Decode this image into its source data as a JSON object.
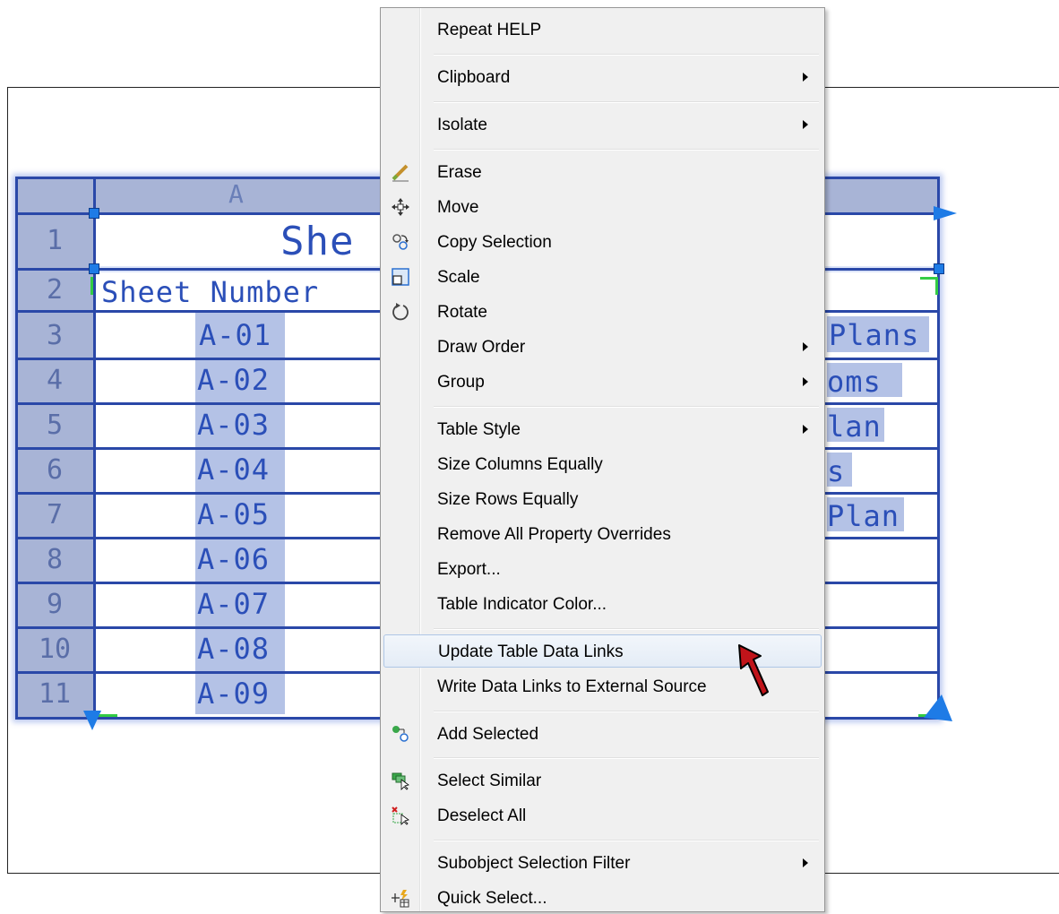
{
  "table": {
    "column_header": "A",
    "row_numbers": [
      "1",
      "2",
      "3",
      "4",
      "5",
      "6",
      "7",
      "8",
      "9",
      "10",
      "11"
    ],
    "title_fragment": "She",
    "header_fragment": "Sheet Number",
    "sheet_numbers": [
      "A-01",
      "A-02",
      "A-03",
      "A-04",
      "A-05",
      "A-06",
      "A-07",
      "A-08",
      "A-09"
    ],
    "right_fragments": [
      "Plans",
      "oms",
      "lan",
      "s",
      "Plan"
    ]
  },
  "menu": {
    "repeat_help": "Repeat HELP",
    "clipboard": "Clipboard",
    "isolate": "Isolate",
    "erase": "Erase",
    "move": "Move",
    "copy_selection": "Copy Selection",
    "scale": "Scale",
    "rotate": "Rotate",
    "draw_order": "Draw Order",
    "group": "Group",
    "table_style": "Table Style",
    "size_columns_equally": "Size Columns Equally",
    "size_rows_equally": "Size Rows Equally",
    "remove_overrides": "Remove All Property Overrides",
    "export": "Export...",
    "table_indicator_color": "Table Indicator Color...",
    "update_table_data_links": "Update Table Data Links",
    "write_data_links": "Write Data Links to External Source",
    "add_selected": "Add Selected",
    "select_similar": "Select Similar",
    "deselect_all": "Deselect All",
    "subobject_selection_filter": "Subobject Selection Filter",
    "quick_select": "Quick Select..."
  },
  "colors": {
    "grid_line": "#2a48a8",
    "cad_text": "#2b4fb8",
    "grip": "#1e7be6",
    "hover_border": "#aec6e6",
    "cursor": "#c0141a"
  },
  "icons": {
    "erase": "eraser-icon",
    "move": "move-arrows-icon",
    "copy_selection": "copy-icon",
    "scale": "scale-icon",
    "rotate": "rotate-icon",
    "add_selected": "add-selected-icon",
    "select_similar": "select-similar-icon",
    "deselect_all": "deselect-all-icon",
    "quick_select": "quick-select-icon",
    "pointer": "mouse-pointer-icon"
  }
}
